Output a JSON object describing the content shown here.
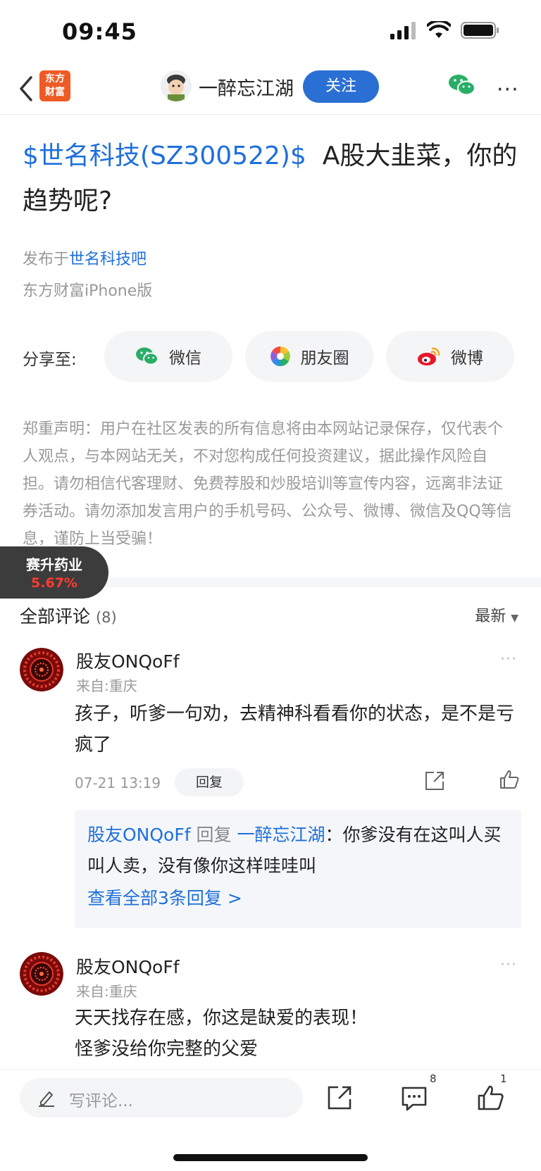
{
  "status_bar": {
    "time": "09:45"
  },
  "nav": {
    "app_logo_text": [
      "东方",
      "财富"
    ],
    "author_name": "一醉忘江湖",
    "follow_label": "关注"
  },
  "post": {
    "title_stock": "$世名科技(SZ300522)$",
    "title_rest": "A股大韭菜，你的趋势呢?",
    "published_prefix": "发布于",
    "published_bar": "世名科技吧",
    "client": "东方财富iPhone版"
  },
  "share": {
    "label": "分享至:",
    "buttons": [
      {
        "label": "微信",
        "icon": "wechat-icon"
      },
      {
        "label": "朋友圈",
        "icon": "moments-icon"
      },
      {
        "label": "微博",
        "icon": "weibo-icon"
      }
    ]
  },
  "disclaimer": "郑重声明：用户在社区发表的所有信息将由本网站记录保存，仅代表个人观点，与本网站无关，不对您构成任何投资建议，据此操作风险自担。请勿相信代客理财、免费荐股和炒股培训等宣传内容，远离非法证券活动。请勿添加发言用户的手机号码、公众号、微博、微信及QQ等信息，谨防上当受骗！",
  "float_stock": {
    "name": "赛升药业",
    "change": "5.67%"
  },
  "comments_header": {
    "label": "全部评论",
    "count": "(8)",
    "sort": "最新"
  },
  "comments": [
    {
      "user": "股友ONQoFf",
      "location": "来自:重庆",
      "text": "孩子，听爹一句劝，去精神科看看你的状态，是不是亏疯了",
      "time": "07-21 13:19",
      "reply_label": "回复",
      "reply_preview": {
        "from": "股友ONQoFf",
        "verb": "回复",
        "to": "一醉忘江湖",
        "sep": "：",
        "text": "你爹没有在这叫人买叫人卖，没有像你这样哇哇叫",
        "view_all": "查看全部3条回复 >"
      }
    },
    {
      "user": "股友ONQoFf",
      "location": "来自:重庆",
      "text_lines": [
        "天天找存在感，你这是缺爱的表现！",
        "怪爹没给你完整的父爱"
      ]
    }
  ],
  "bottom_bar": {
    "input_placeholder": "写评论...",
    "comment_count": "8",
    "like_count": "1"
  },
  "colors": {
    "link_blue": "#1e6fdc",
    "follow_blue": "#2a6fd3",
    "logo_orange": "#ee5a24",
    "up_red": "#ff3b30"
  }
}
